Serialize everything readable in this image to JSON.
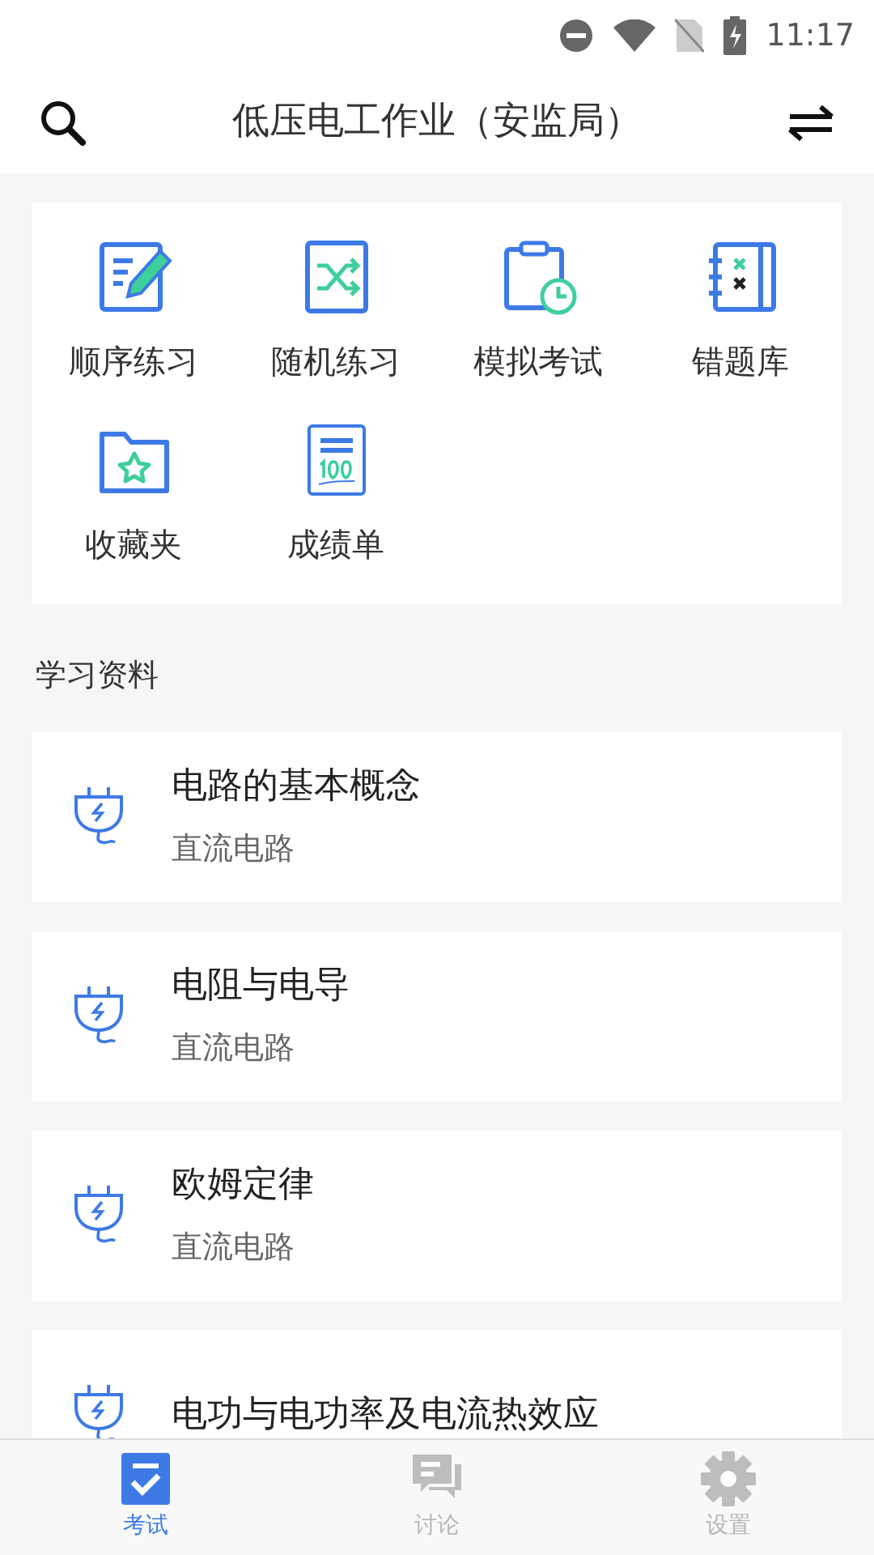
{
  "status_bar": {
    "time": "11:17"
  },
  "header": {
    "title": "低压电工作业（安监局）"
  },
  "features": [
    {
      "label": "顺序练习",
      "kind": "edit"
    },
    {
      "label": "随机练习",
      "kind": "shuffle"
    },
    {
      "label": "模拟考试",
      "kind": "exam"
    },
    {
      "label": "错题库",
      "kind": "wrong"
    },
    {
      "label": "收藏夹",
      "kind": "favorite"
    },
    {
      "label": "成绩单",
      "kind": "score"
    }
  ],
  "section_title": "学习资料",
  "materials": [
    {
      "title": "电路的基本概念",
      "subtitle": "直流电路"
    },
    {
      "title": "电阻与电导",
      "subtitle": "直流电路"
    },
    {
      "title": "欧姆定律",
      "subtitle": "直流电路"
    },
    {
      "title": "电功与电功率及电流热效应"
    }
  ],
  "tabs": [
    {
      "label": "考试",
      "kind": "exam",
      "selected": true
    },
    {
      "label": "讨论",
      "kind": "chat",
      "selected": false
    },
    {
      "label": "设置",
      "kind": "settings",
      "selected": false
    }
  ]
}
